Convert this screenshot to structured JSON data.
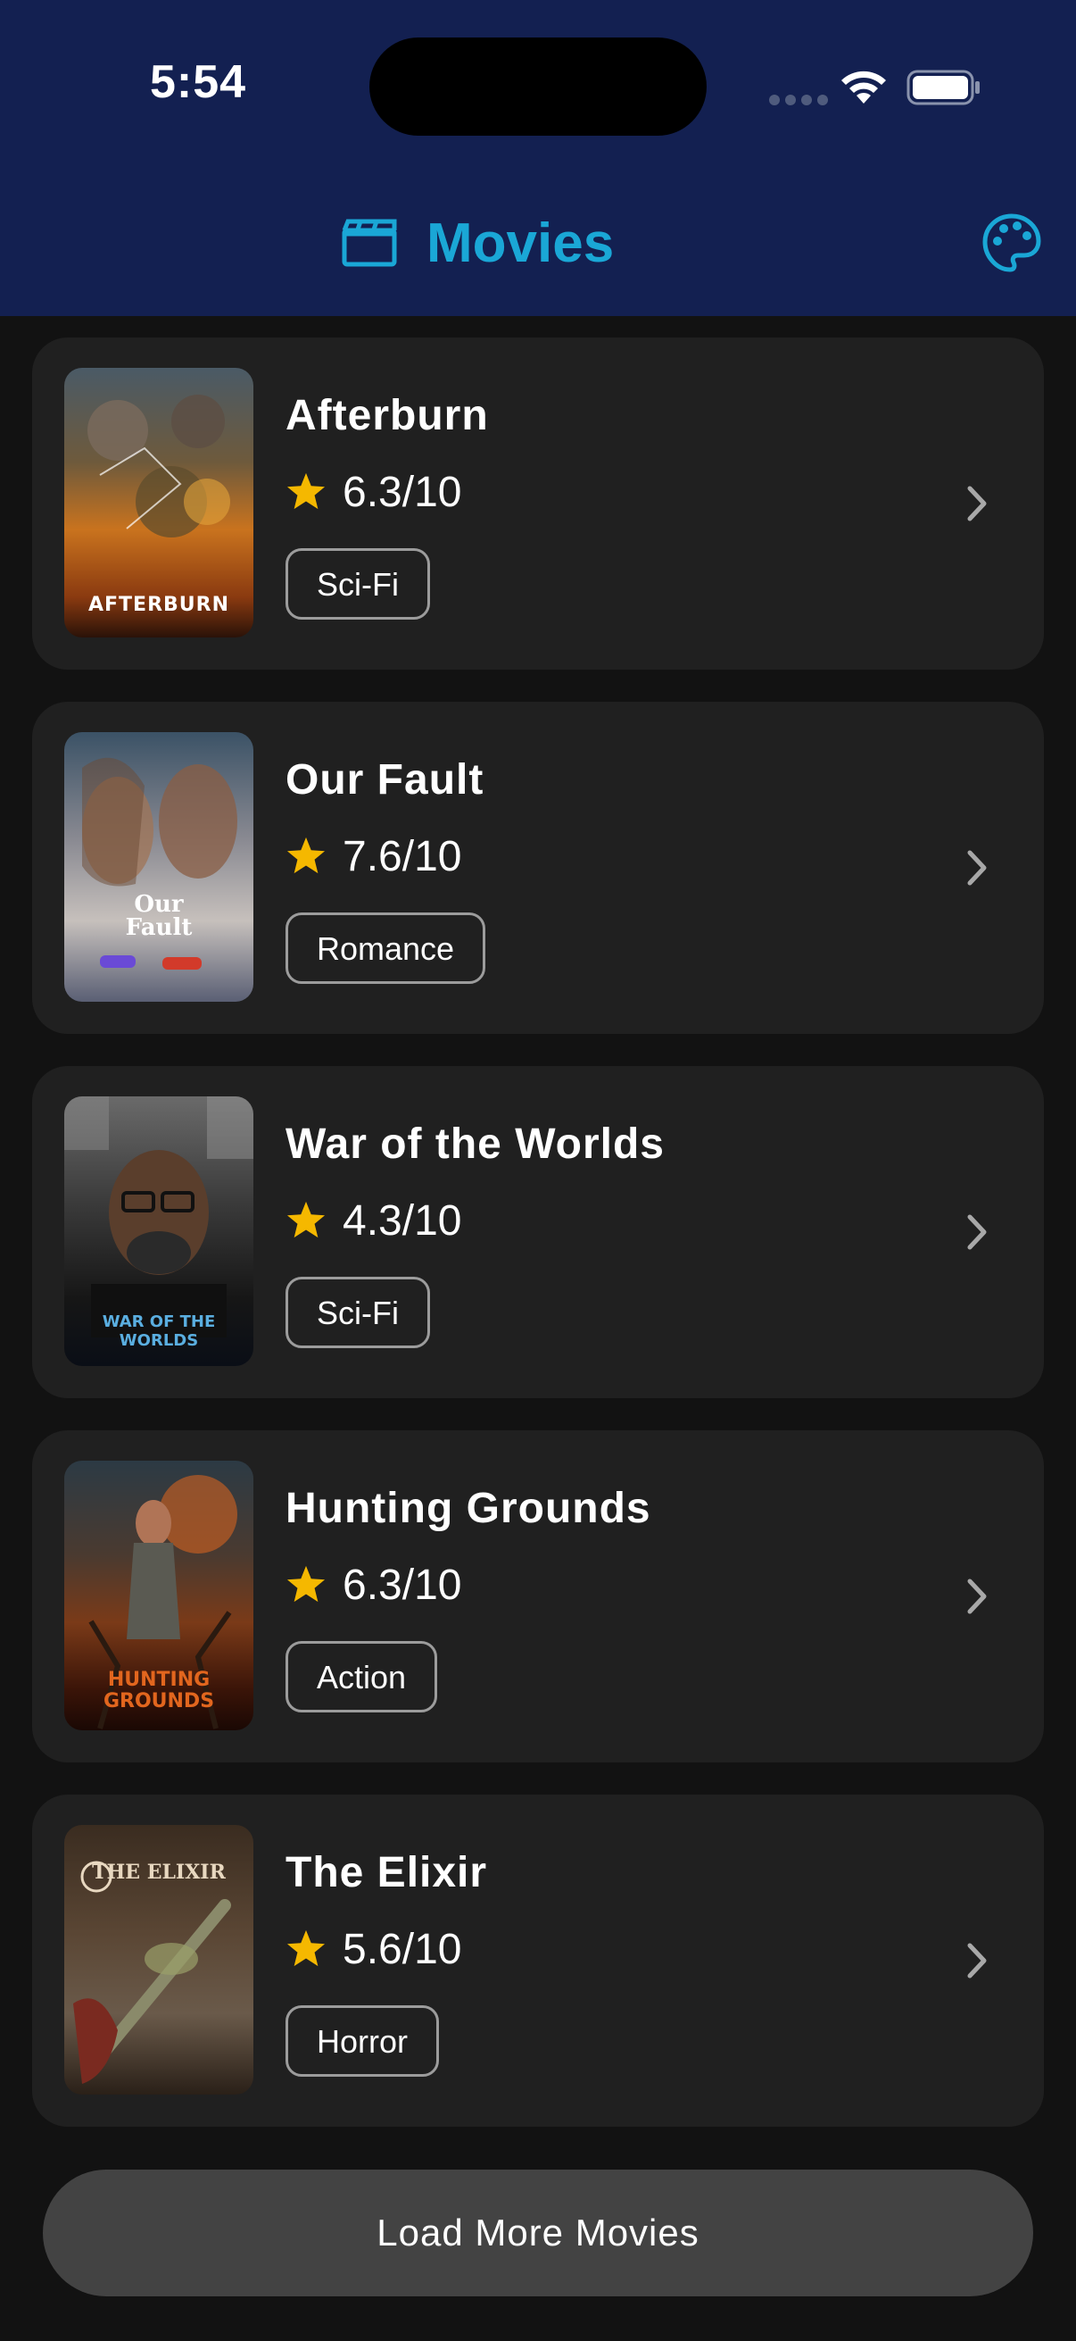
{
  "status_bar": {
    "time": "5:54"
  },
  "header": {
    "title": "Movies"
  },
  "movies": [
    {
      "title": "Afterburn",
      "rating": "6.3/10",
      "genre": "Sci-Fi",
      "poster_text": "AFTERBURN"
    },
    {
      "title": "Our Fault",
      "rating": "7.6/10",
      "genre": "Romance",
      "poster_text": "Our Fault"
    },
    {
      "title": "War of the Worlds",
      "rating": "4.3/10",
      "genre": "Sci-Fi",
      "poster_text": "WAR OF THE WORLDS"
    },
    {
      "title": "Hunting Grounds",
      "rating": "6.3/10",
      "genre": "Action",
      "poster_text": "HUNTING GROUNDS"
    },
    {
      "title": "The Elixir",
      "rating": "5.6/10",
      "genre": "Horror",
      "poster_text": "THE ELIXIR"
    }
  ],
  "load_more_label": "Load More Movies",
  "colors": {
    "header_bg": "#132051",
    "accent": "#1aa7d6",
    "star": "#f5b800",
    "card_bg": "#202020",
    "button_bg": "#434343"
  },
  "icons": [
    "clapperboard-icon",
    "palette-icon",
    "star-icon",
    "chevron-right-icon",
    "wifi-icon",
    "battery-icon",
    "cellular-signal-icon"
  ]
}
